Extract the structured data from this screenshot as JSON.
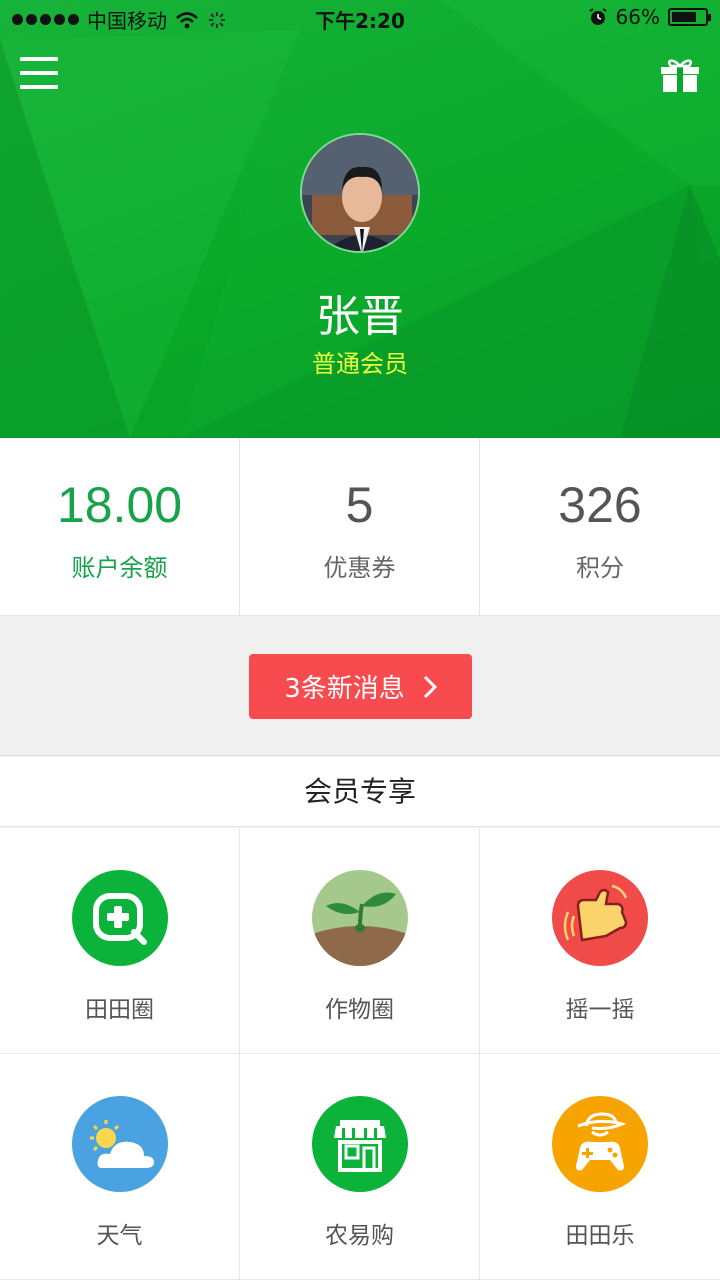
{
  "status_bar": {
    "carrier": "中国移动",
    "time": "下午2:20",
    "battery": "66%"
  },
  "header": {
    "username": "张晋",
    "member_level": "普通会员",
    "menu_icon": "hamburger-menu-icon",
    "gift_icon": "gift-icon",
    "accent_color": "#0aa82a",
    "level_color": "#eaff3d"
  },
  "stats": [
    {
      "value": "18.00",
      "label": "账户余额"
    },
    {
      "value": "5",
      "label": "优惠券"
    },
    {
      "value": "326",
      "label": "积分"
    }
  ],
  "message": {
    "label": "3条新消息",
    "color": "#f84b4f"
  },
  "section": {
    "title": "会员专享"
  },
  "features": [
    {
      "label": "田田圈",
      "icon": "search-plus-icon",
      "color": "#0bb33b"
    },
    {
      "label": "作物圈",
      "icon": "sprout-icon",
      "color": "#a5c98c"
    },
    {
      "label": "摇一摇",
      "icon": "shake-hand-icon",
      "color": "#f04b48"
    },
    {
      "label": "天气",
      "icon": "weather-cloud-sun-icon",
      "color": "#4aa3e0"
    },
    {
      "label": "农易购",
      "icon": "shop-icon",
      "color": "#0bb33b"
    },
    {
      "label": "田田乐",
      "icon": "gamepad-icon",
      "color": "#f8a400"
    }
  ]
}
